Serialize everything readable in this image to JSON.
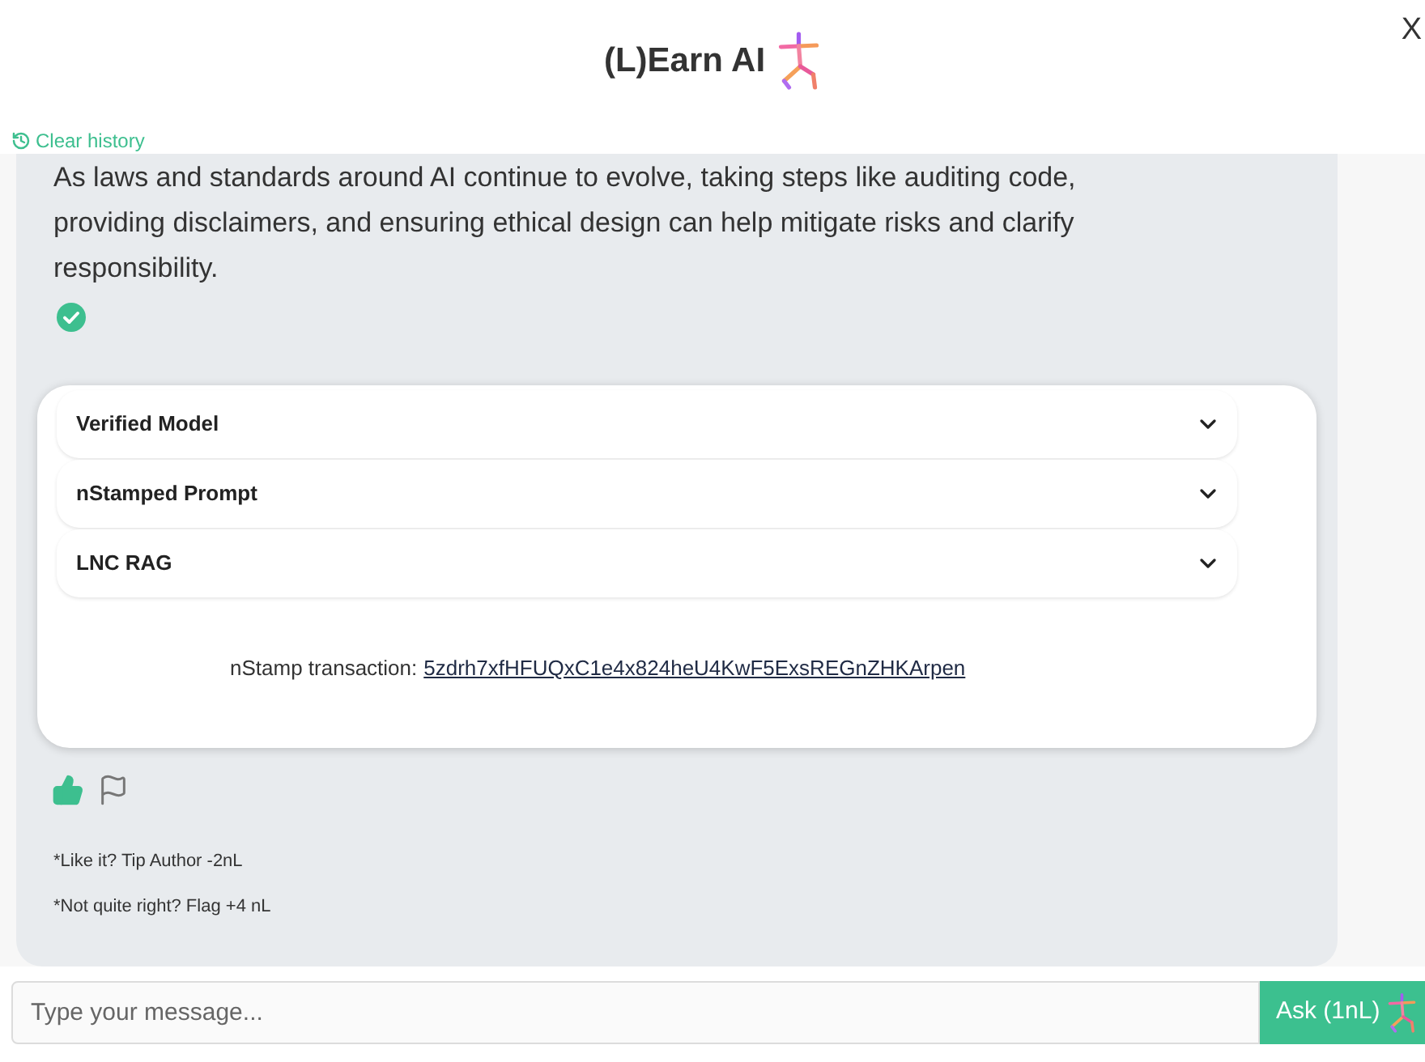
{
  "header": {
    "title": "(L)Earn AI",
    "close": "X",
    "clear_history": "Clear history"
  },
  "message": {
    "text": "As laws and standards around AI continue to evolve, taking steps like auditing code, providing disclaimers, and ensuring ethical design can help mitigate risks and clarify responsibility.",
    "verified": true,
    "card": {
      "sections": [
        {
          "label": "Verified Model",
          "expanded": false
        },
        {
          "label": "nStamped Prompt",
          "expanded": false
        },
        {
          "label": "LNC RAG",
          "expanded": false
        }
      ],
      "transaction_label": "nStamp transaction:",
      "transaction_link": "5zdrh7xfHFUQxC1e4x824heU4KwF5ExsREGnZHKArpen"
    },
    "feedback": {
      "liked": true,
      "flagged": false
    },
    "notes": [
      "*Like it? Tip Author -2nL",
      "*Not quite right? Flag +4 nL"
    ]
  },
  "composer": {
    "placeholder": "Type your message...",
    "button": "Ask (1nL)"
  }
}
